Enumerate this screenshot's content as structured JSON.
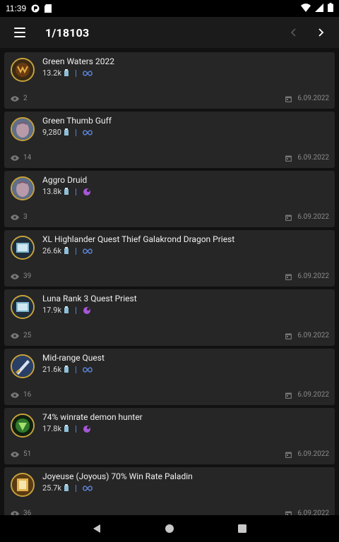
{
  "status_bar": {
    "time": "11:39"
  },
  "app_bar": {
    "counter": "1/18103"
  },
  "decks": [
    {
      "title": "Green Waters 2022",
      "dust": "13.2k",
      "format": "wild",
      "views": "2",
      "date": "6.09.2022",
      "hero": "demon-hunter"
    },
    {
      "title": "Green Thumb Guff",
      "dust": "9,280",
      "format": "wild",
      "views": "14",
      "date": "6.09.2022",
      "hero": "druid"
    },
    {
      "title": "Aggro Druid",
      "dust": "13.8k",
      "format": "standard",
      "views": "3",
      "date": "6.09.2022",
      "hero": "druid"
    },
    {
      "title": "XL Highlander Quest Thief Galakrond Dragon Priest",
      "dust": "26.6k",
      "format": "wild",
      "views": "39",
      "date": "6.09.2022",
      "hero": "priest"
    },
    {
      "title": "Luna Rank 3 Quest Priest",
      "dust": "17.9k",
      "format": "standard",
      "views": "25",
      "date": "6.09.2022",
      "hero": "priest"
    },
    {
      "title": "Mid-range Quest",
      "dust": "21.6k",
      "format": "wild",
      "views": "16",
      "date": "6.09.2022",
      "hero": "warrior"
    },
    {
      "title": "74% winrate demon hunter",
      "dust": "17.8k",
      "format": "standard",
      "views": "51",
      "date": "6.09.2022",
      "hero": "demon-hunter-green"
    },
    {
      "title": "Joyeuse (Joyous) 70% Win Rate Paladin",
      "dust": "25.7k",
      "format": "wild",
      "views": "36",
      "date": "6.09.2022",
      "hero": "paladin"
    }
  ],
  "colors": {
    "card_bg": "#262626",
    "hero_border": "#c9a33a",
    "wild_icon": "#5a7fcf",
    "standard_icon": "#a656d6",
    "dust_icon": "#8fbfd6"
  }
}
